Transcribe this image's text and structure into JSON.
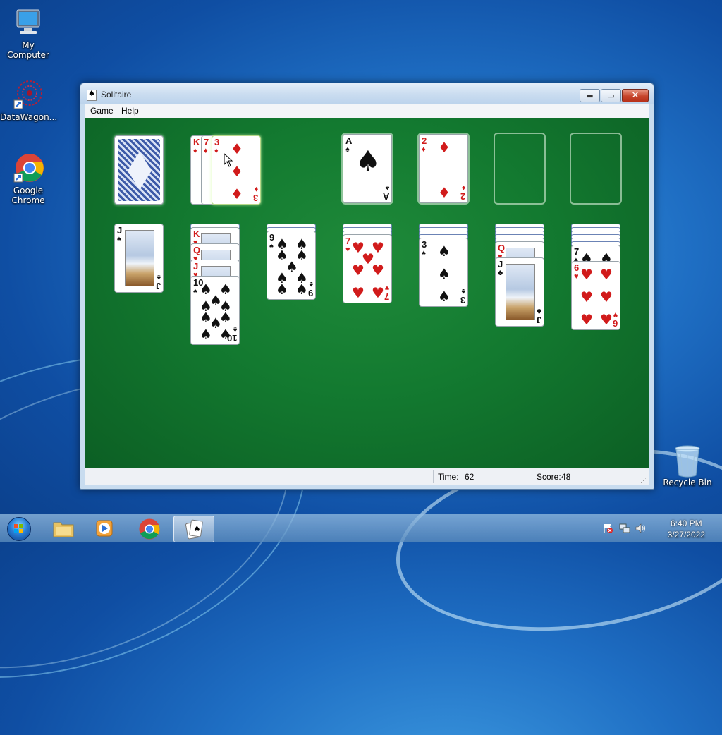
{
  "desktop": {
    "icons": [
      {
        "label": "My Computer",
        "icon": "computer-icon"
      },
      {
        "label": "DataWagon...",
        "icon": "datawagon-icon"
      },
      {
        "label": "Google Chrome",
        "icon": "chrome-icon"
      },
      {
        "label": "Recycle Bin",
        "icon": "recycle-bin-icon"
      }
    ]
  },
  "window": {
    "title": "Solitaire",
    "menu": [
      "Game",
      "Help"
    ],
    "status": {
      "time_label": "Time:",
      "time_value": "62",
      "score_label": "Score:",
      "score_value": "48"
    }
  },
  "game": {
    "stock": "face-down",
    "waste": [
      {
        "rank": "K",
        "suit": "♦",
        "color": "red"
      },
      {
        "rank": "7",
        "suit": "♦",
        "color": "red"
      },
      {
        "rank": "3",
        "suit": "♦",
        "color": "red"
      }
    ],
    "foundations": [
      {
        "rank": "A",
        "suit": "♠",
        "color": "black"
      },
      {
        "rank": "2",
        "suit": "♦",
        "color": "red"
      },
      {
        "rank": "",
        "suit": "",
        "color": ""
      },
      {
        "rank": "",
        "suit": "",
        "color": ""
      }
    ],
    "tableau": [
      {
        "hidden": 0,
        "cards": [
          {
            "rank": "J",
            "suit": "♠",
            "color": "black"
          }
        ]
      },
      {
        "hidden": 1,
        "cards": [
          {
            "rank": "K",
            "suit": "♥",
            "color": "red"
          },
          {
            "rank": "Q",
            "suit": "♥",
            "color": "red"
          },
          {
            "rank": "J",
            "suit": "♥",
            "color": "red"
          },
          {
            "rank": "10",
            "suit": "♠",
            "color": "black"
          }
        ]
      },
      {
        "hidden": 2,
        "cards": [
          {
            "rank": "9",
            "suit": "♠",
            "color": "black"
          }
        ]
      },
      {
        "hidden": 3,
        "cards": [
          {
            "rank": "7",
            "suit": "♥",
            "color": "red"
          }
        ]
      },
      {
        "hidden": 4,
        "cards": [
          {
            "rank": "3",
            "suit": "♠",
            "color": "black"
          }
        ]
      },
      {
        "hidden": 5,
        "cards": [
          {
            "rank": "Q",
            "suit": "♥",
            "color": "red"
          },
          {
            "rank": "J",
            "suit": "♣",
            "color": "black"
          }
        ]
      },
      {
        "hidden": 6,
        "cards": [
          {
            "rank": "7",
            "suit": "♠",
            "color": "black"
          },
          {
            "rank": "6",
            "suit": "♥",
            "color": "red"
          }
        ]
      }
    ]
  },
  "taskbar": {
    "pinned": [
      "start-orb-icon",
      "folder-icon",
      "media-player-icon",
      "chrome-icon",
      "solitaire-icon"
    ],
    "tray_icons": [
      "action-center-flag-icon",
      "network-icon",
      "volume-icon"
    ],
    "clock_time": "6:40 PM",
    "clock_date": "3/27/2022"
  }
}
